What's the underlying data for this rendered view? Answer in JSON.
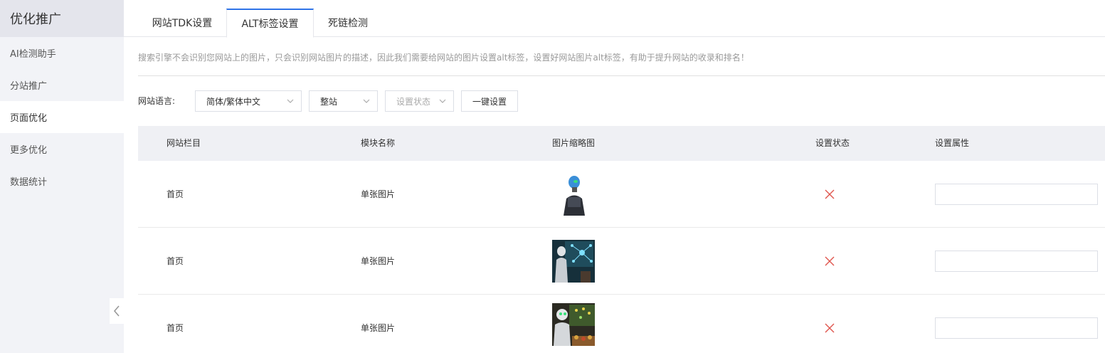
{
  "sidebar": {
    "title": "优化推广",
    "items": [
      {
        "label": "AI检测助手",
        "active": false
      },
      {
        "label": "分站推广",
        "active": false
      },
      {
        "label": "页面优化",
        "active": true
      },
      {
        "label": "更多优化",
        "active": false
      },
      {
        "label": "数据统计",
        "active": false
      }
    ]
  },
  "tabs": [
    {
      "label": "网站TDK设置",
      "active": false
    },
    {
      "label": "ALT标签设置",
      "active": true
    },
    {
      "label": "死链检测",
      "active": false
    }
  ],
  "notice": "搜索引擎不会识别您网站上的图片，只会识别网站图片的描述，因此我们需要给网站的图片设置alt标签，设置好网站图片alt标签，有助于提升网站的收录和排名！",
  "filters": {
    "language_label": "网站语言:",
    "language_value": "简体/繁体中文",
    "scope_value": "整站",
    "status_placeholder": "设置状态",
    "one_click_label": "一键设置"
  },
  "table": {
    "headers": [
      "网站栏目",
      "模块名称",
      "图片缩略图",
      "设置状态",
      "设置属性"
    ],
    "rows": [
      {
        "column": "首页",
        "module": "单张图片",
        "thumb": "robot-silhouette-image",
        "status": "not-set",
        "alt": ""
      },
      {
        "column": "首页",
        "module": "单张图片",
        "thumb": "robot-network-image",
        "status": "not-set",
        "alt": ""
      },
      {
        "column": "首页",
        "module": "单张图片",
        "thumb": "robot-market-image",
        "status": "not-set",
        "alt": ""
      }
    ]
  },
  "colors": {
    "accent": "#2f74e8",
    "status_x": "#e0574f",
    "sidebar_bg": "#f2f3f7",
    "table_header_bg": "#eff0f4"
  }
}
